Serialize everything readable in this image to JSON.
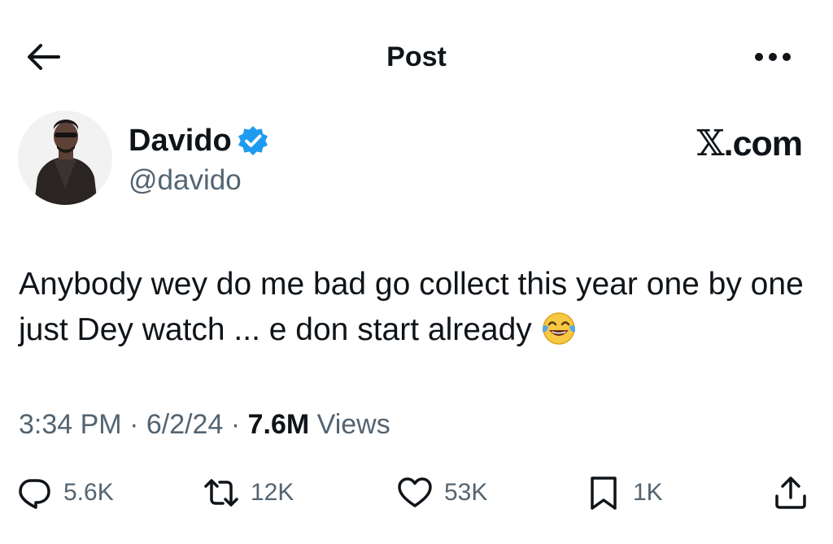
{
  "header": {
    "title": "Post",
    "back_icon": "arrow-left-icon",
    "more_icon": "ellipsis-icon"
  },
  "author": {
    "name": "Davido",
    "handle": "@davido",
    "verified": true,
    "verified_color": "#1d9bf0"
  },
  "brand": {
    "x": "𝕏",
    "suffix": ".com"
  },
  "tweet": {
    "text": "Anybody wey do me bad go collect this year one by one just Dey watch ... e don start already",
    "emoji": "face-with-tears-of-joy-icon"
  },
  "meta": {
    "time": "3:34 PM",
    "sep1": " · ",
    "date": "6/2/24",
    "sep2": " · ",
    "views_count": "7.6M",
    "views_label": " Views"
  },
  "actions": {
    "reply": {
      "count": "5.6K",
      "icon": "reply-icon"
    },
    "retweet": {
      "count": "12K",
      "icon": "retweet-icon"
    },
    "like": {
      "count": "53K",
      "icon": "heart-icon"
    },
    "bookmark": {
      "count": "1K",
      "icon": "bookmark-icon"
    },
    "share": {
      "icon": "share-icon"
    }
  },
  "colors": {
    "text": "#0f1419",
    "secondary": "#536471",
    "accent": "#1d9bf0"
  }
}
